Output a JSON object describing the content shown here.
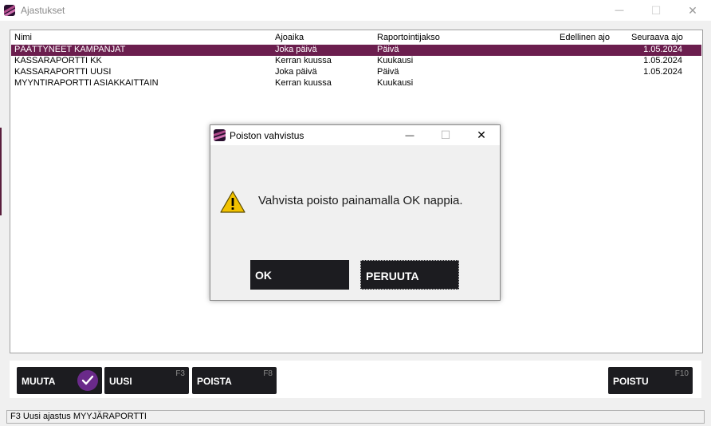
{
  "window": {
    "title": "Ajastukset",
    "minimize_glyph": "—",
    "maximize_glyph": "☐",
    "close_glyph": "✕"
  },
  "list": {
    "columns": [
      "Nimi",
      "Ajoaika",
      "Raportointijakso",
      "Edellinen ajo",
      "Seuraava ajo"
    ],
    "rows": [
      [
        "PÄÄTTYNEET KAMPANJAT",
        "Joka päivä",
        "Päivä",
        "",
        "1.05.2024"
      ],
      [
        "KASSARAPORTTI KK",
        "Kerran kuussa",
        "Kuukausi",
        "",
        "1.05.2024"
      ],
      [
        "KASSARAPORTTI UUSI",
        "Joka päivä",
        "Päivä",
        "",
        "1.05.2024"
      ],
      [
        "MYYNTIRAPORTTI ASIAKKAITTAIN",
        "Kerran kuussa",
        "Kuukausi",
        "",
        ""
      ]
    ],
    "selected_row": 0
  },
  "toolbar": {
    "buttons": [
      {
        "label": "MUUTA",
        "key": "",
        "icon": "check-icon"
      },
      {
        "label": "UUSI",
        "key": "F3"
      },
      {
        "label": "POISTA",
        "key": "F8"
      },
      {
        "label": "POISTU",
        "key": "F10"
      }
    ]
  },
  "status": {
    "text": "F3 Uusi ajastus MYYJÄRAPORTTI"
  },
  "dialog": {
    "title": "Poiston vahvistus",
    "message": "Vahvista poisto painamalla OK nappia.",
    "ok_label": "OK",
    "cancel_label": "PERUUTA",
    "icon": "warning-icon",
    "minimize_glyph": "—",
    "maximize_glyph": "☐",
    "close_glyph": "✕"
  },
  "colors": {
    "selection": "#6b1e4e",
    "button_bg": "#1c1c20",
    "accent_purple": "#6a2a8a",
    "warning_yellow": "#f2c200"
  }
}
